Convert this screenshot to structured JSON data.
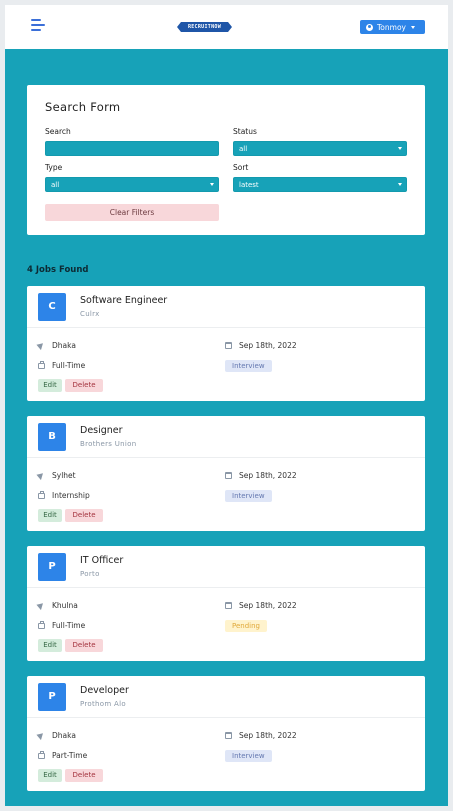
{
  "navbar": {
    "logo_text": "RECRUITNOW",
    "user_name": "Tonmoy"
  },
  "search_form": {
    "title": "Search Form",
    "search_label": "Search",
    "search_value": "",
    "status_label": "Status",
    "status_value": "all",
    "type_label": "Type",
    "type_value": "all",
    "sort_label": "Sort",
    "sort_value": "latest",
    "clear_label": "Clear Filters"
  },
  "jobs_found": "4 Jobs Found",
  "jobs": [
    {
      "initial": "C",
      "title": "Software Engineer",
      "company": "Culrx",
      "location": "Dhaka",
      "date": "Sep 18th, 2022",
      "type": "Full-Time",
      "status": "Interview"
    },
    {
      "initial": "B",
      "title": "Designer",
      "company": "Brothers Union",
      "location": "Sylhet",
      "date": "Sep 18th, 2022",
      "type": "Internship",
      "status": "Interview"
    },
    {
      "initial": "P",
      "title": "IT Officer",
      "company": "Porto",
      "location": "Khulna",
      "date": "Sep 18th, 2022",
      "type": "Full-Time",
      "status": "Pending"
    },
    {
      "initial": "P",
      "title": "Developer",
      "company": "Prothom Alo",
      "location": "Dhaka",
      "date": "Sep 18th, 2022",
      "type": "Part-Time",
      "status": "Interview"
    }
  ],
  "actions": {
    "edit_label": "Edit",
    "delete_label": "Delete"
  },
  "icons": {
    "menu": "hamburger-menu-icon",
    "user": "user-circle-icon",
    "location": "location-arrow-icon",
    "calendar": "calendar-icon",
    "job_type": "briefcase-icon"
  },
  "colors": {
    "background": "#17a2b8",
    "primary": "#2d84e8",
    "danger_light": "#f8d7da",
    "success_light": "#d4ecdc",
    "interview": "#dfe6f7",
    "pending": "#fff3cd"
  }
}
